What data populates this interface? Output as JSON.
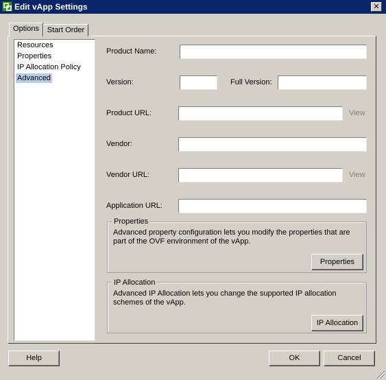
{
  "window": {
    "title": "Edit vApp Settings",
    "close_label": "✕",
    "app_icon": "vapp-icon"
  },
  "tabs": [
    {
      "label": "Options",
      "selected": true
    },
    {
      "label": "Start Order",
      "selected": false
    }
  ],
  "sidebar": {
    "items": [
      {
        "label": "Resources"
      },
      {
        "label": "Properties"
      },
      {
        "label": "IP Allocation Policy"
      },
      {
        "label": "Advanced",
        "selected": true
      }
    ]
  },
  "form": {
    "product_name_label": "Product Name:",
    "product_name_value": "",
    "version_label": "Version:",
    "version_value": "",
    "full_version_label": "Full Version:",
    "full_version_value": "",
    "product_url_label": "Product URL:",
    "product_url_value": "",
    "product_url_view": "View",
    "vendor_label": "Vendor:",
    "vendor_value": "",
    "vendor_url_label": "Vendor URL:",
    "vendor_url_value": "",
    "vendor_url_view": "View",
    "application_url_label": "Application URL:",
    "application_url_value": ""
  },
  "properties_group": {
    "title": "Properties",
    "description": "Advanced property configuration lets you modify the properties that are part of the OVF environment of the vApp.",
    "button": "Properties"
  },
  "ip_allocation_group": {
    "title": "IP Allocation",
    "description": "Advanced IP Allocation lets you change the supported IP allocation schemes of the vApp.",
    "button": "IP Allocation"
  },
  "footer": {
    "help": "Help",
    "ok": "OK",
    "cancel": "Cancel"
  },
  "colors": {
    "titlebar": "#0a246a",
    "dialog_bg": "#d4d0c8",
    "selection": "#b8cde8",
    "muted_link": "#808080"
  }
}
